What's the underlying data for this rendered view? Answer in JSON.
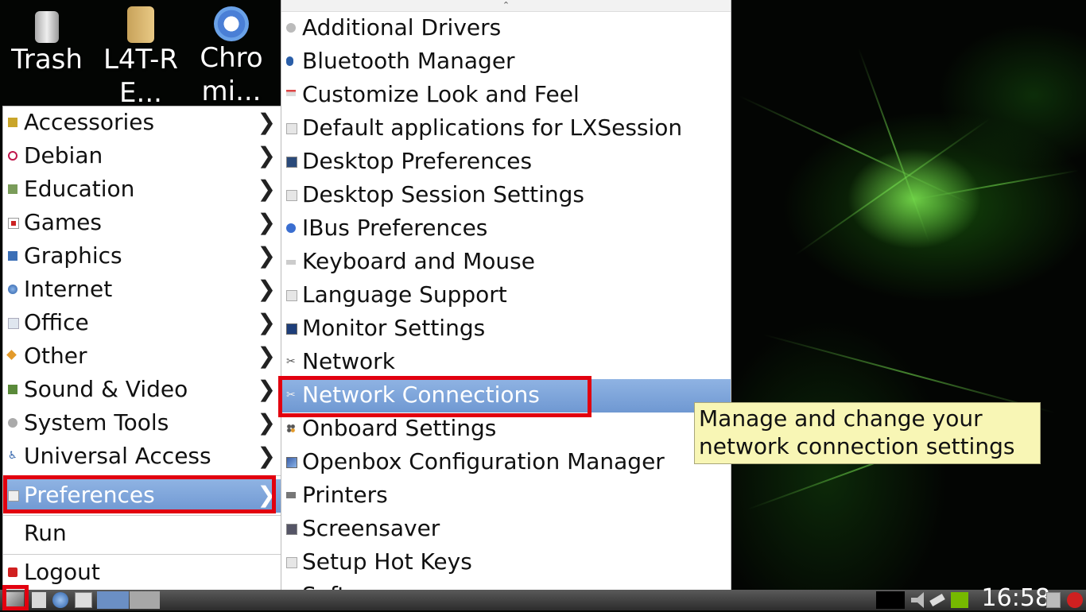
{
  "desktop": {
    "icons": [
      {
        "label": "Trash",
        "icon": "trash-icon"
      },
      {
        "label": "L4T-RE...",
        "icon": "folder-icon"
      },
      {
        "label": "Chromi...",
        "icon": "chromium-icon"
      }
    ]
  },
  "main_menu": {
    "items": [
      {
        "label": "Accessories",
        "icon": "accessories-icon",
        "arrow": "❯"
      },
      {
        "label": "Debian",
        "icon": "debian-icon",
        "arrow": "❯"
      },
      {
        "label": "Education",
        "icon": "education-icon",
        "arrow": "❯"
      },
      {
        "label": "Games",
        "icon": "games-icon",
        "arrow": "❯"
      },
      {
        "label": "Graphics",
        "icon": "graphics-icon",
        "arrow": "❯"
      },
      {
        "label": "Internet",
        "icon": "internet-icon",
        "arrow": "❯"
      },
      {
        "label": "Office",
        "icon": "office-icon",
        "arrow": "❯"
      },
      {
        "label": "Other",
        "icon": "other-icon",
        "arrow": "❯"
      },
      {
        "label": "Sound & Video",
        "icon": "sound-video-icon",
        "arrow": "❯"
      },
      {
        "label": "System Tools",
        "icon": "system-tools-icon",
        "arrow": "❯"
      },
      {
        "label": "Universal Access",
        "icon": "universal-access-icon",
        "arrow": "❯"
      },
      {
        "label": "Preferences",
        "icon": "preferences-icon",
        "arrow": "❯",
        "selected": true
      }
    ],
    "run_label": "Run",
    "logout_label": "Logout"
  },
  "submenu": {
    "scroll_up": "⌃",
    "scroll_down": "⌄",
    "items": [
      {
        "label": "Additional Drivers",
        "icon": "drivers-icon"
      },
      {
        "label": "Bluetooth Manager",
        "icon": "bluetooth-icon"
      },
      {
        "label": "Customize Look and Feel",
        "icon": "appearance-icon"
      },
      {
        "label": "Default applications for LXSession",
        "icon": "session-icon"
      },
      {
        "label": "Desktop Preferences",
        "icon": "desktop-icon"
      },
      {
        "label": "Desktop Session Settings",
        "icon": "session-settings-icon"
      },
      {
        "label": "IBus Preferences",
        "icon": "ibus-icon"
      },
      {
        "label": "Keyboard and Mouse",
        "icon": "keyboard-mouse-icon"
      },
      {
        "label": "Language Support",
        "icon": "language-icon"
      },
      {
        "label": "Monitor Settings",
        "icon": "monitor-icon"
      },
      {
        "label": "Network",
        "icon": "network-icon"
      },
      {
        "label": "Network Connections",
        "icon": "network-connections-icon",
        "selected": true
      },
      {
        "label": "Onboard Settings",
        "icon": "onboard-icon"
      },
      {
        "label": "Openbox Configuration Manager",
        "icon": "openbox-icon"
      },
      {
        "label": "Printers",
        "icon": "printer-icon"
      },
      {
        "label": "Screensaver",
        "icon": "screensaver-icon"
      },
      {
        "label": "Setup Hot Keys",
        "icon": "hotkeys-icon"
      },
      {
        "label": "Software",
        "icon": "software-icon"
      }
    ]
  },
  "tooltip": {
    "line1": "Manage and change your",
    "line2": "network connection settings"
  },
  "taskbar": {
    "clock": "16:58"
  },
  "colors": {
    "selection": "#7ea6da",
    "highlight_box": "#e2000f",
    "tooltip_bg": "#f8f6b5"
  }
}
